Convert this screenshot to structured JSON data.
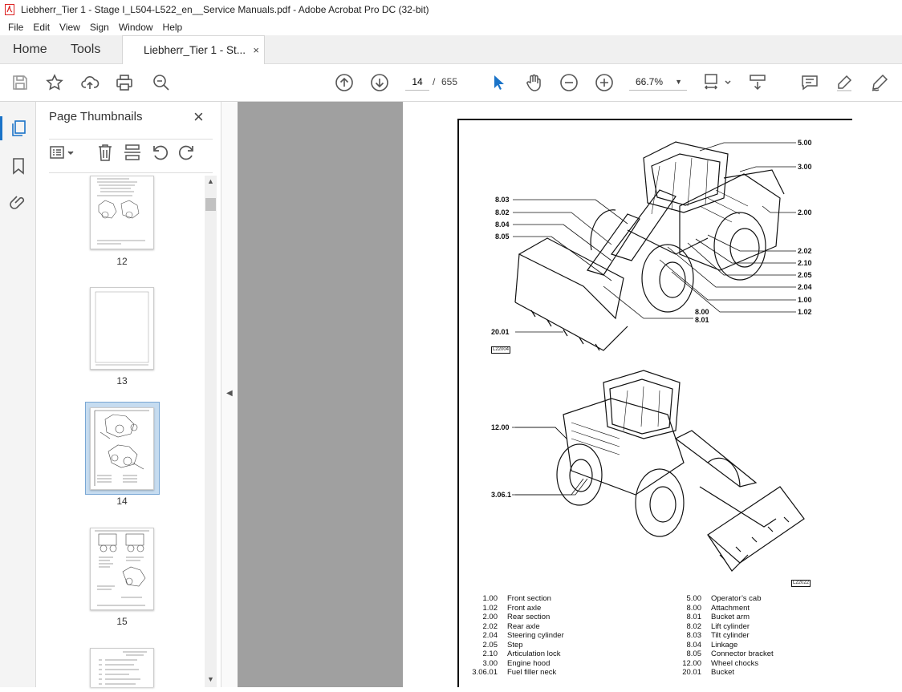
{
  "window": {
    "title": "Liebherr_Tier 1 - Stage I_L504-L522_en__Service Manuals.pdf - Adobe Acrobat Pro DC (32-bit)"
  },
  "menu": [
    "File",
    "Edit",
    "View",
    "Sign",
    "Window",
    "Help"
  ],
  "tabs": {
    "home": "Home",
    "tools": "Tools",
    "doc": "Liebherr_Tier 1 - St...",
    "close": "×"
  },
  "toolbar": {
    "page_current": "14",
    "page_sep": "/",
    "page_total": "655",
    "zoom": "66.7%"
  },
  "panel": {
    "title": "Page Thumbnails",
    "close": "×"
  },
  "thumbnails": [
    {
      "num": "12",
      "selected": false
    },
    {
      "num": "13",
      "selected": false
    },
    {
      "num": "14",
      "selected": true
    },
    {
      "num": "15",
      "selected": false
    }
  ],
  "figure1": {
    "code": "L22004",
    "labels": [
      "5.00",
      "3.00",
      "2.00",
      "8.03",
      "8.02",
      "8.04",
      "8.05",
      "2.02",
      "2.10",
      "2.05",
      "2.04",
      "1.00",
      "1.02",
      "8.00",
      "8.01",
      "20.01"
    ]
  },
  "figure2": {
    "code": "L22022",
    "labels": [
      "12.00",
      "3.06.1"
    ]
  },
  "legend": {
    "left": [
      {
        "code": "1.00",
        "name": "Front section"
      },
      {
        "code": "1.02",
        "name": "Front axle"
      },
      {
        "code": "2.00",
        "name": "Rear section"
      },
      {
        "code": "2.02",
        "name": "Rear axle"
      },
      {
        "code": "2.04",
        "name": "Steering cylinder"
      },
      {
        "code": "2.05",
        "name": "Step"
      },
      {
        "code": "2.10",
        "name": "Articulation lock"
      },
      {
        "code": "3.00",
        "name": "Engine hood"
      },
      {
        "code": "3.06.01",
        "name": "Fuel filler neck"
      }
    ],
    "right": [
      {
        "code": "5.00",
        "name": "Operator’s cab"
      },
      {
        "code": "8.00",
        "name": "Attachment"
      },
      {
        "code": "8.01",
        "name": "Bucket arm"
      },
      {
        "code": "8.02",
        "name": "Lift cylinder"
      },
      {
        "code": "8.03",
        "name": "Tilt cylinder"
      },
      {
        "code": "8.04",
        "name": "Linkage"
      },
      {
        "code": "8.05",
        "name": "Connector bracket"
      },
      {
        "code": "12.00",
        "name": "Wheel chocks"
      },
      {
        "code": "20.01",
        "name": "Bucket"
      }
    ]
  }
}
